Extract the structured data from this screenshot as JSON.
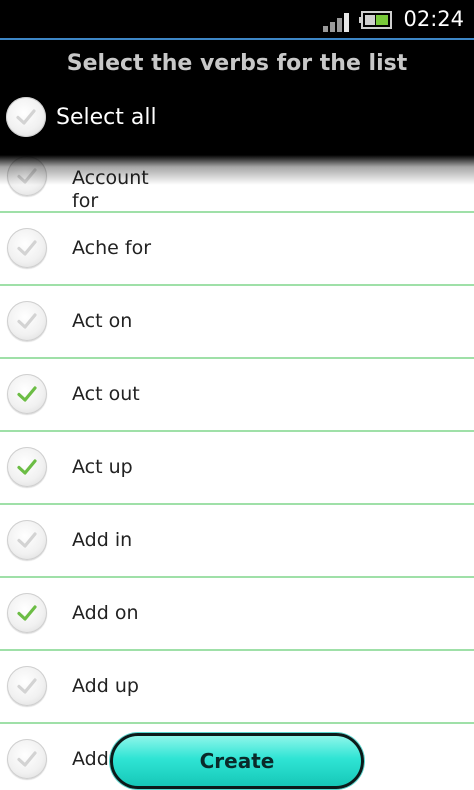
{
  "status_bar": {
    "time": "02:24",
    "icons": [
      "signal-icon",
      "battery-icon"
    ]
  },
  "header": {
    "title": "Select the verbs for the list",
    "select_all_label": "Select all",
    "select_all_checked": false
  },
  "list": {
    "items": [
      {
        "label": "Account for",
        "checked": false
      },
      {
        "label": "Ache for",
        "checked": false
      },
      {
        "label": "Act on",
        "checked": false
      },
      {
        "label": "Act out",
        "checked": true
      },
      {
        "label": "Act up",
        "checked": true
      },
      {
        "label": "Add in",
        "checked": false
      },
      {
        "label": "Add on",
        "checked": true
      },
      {
        "label": "Add up",
        "checked": false
      },
      {
        "label": "Add",
        "checked": false
      }
    ]
  },
  "create_button": {
    "label": "Create"
  },
  "colors": {
    "check_on": "#6cbd45",
    "check_off": "#d3d3d3",
    "divider": "#9fe0a8",
    "button": "#2fe4d4"
  }
}
